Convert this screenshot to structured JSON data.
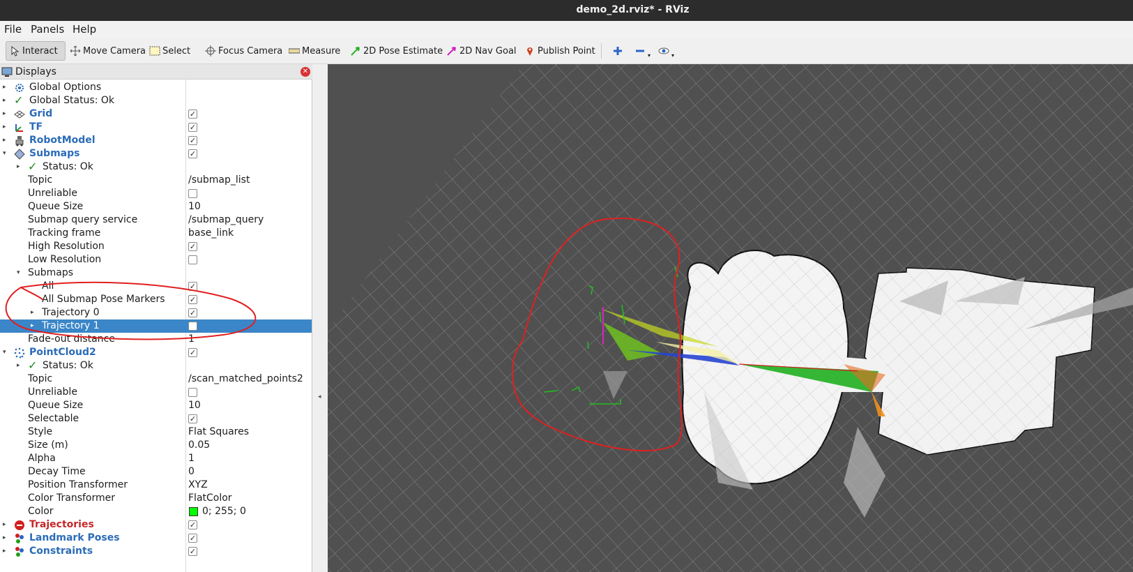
{
  "window": {
    "title": "demo_2d.rviz* - RViz"
  },
  "menubar": {
    "items": [
      "File",
      "Panels",
      "Help"
    ]
  },
  "toolbar": {
    "tools": [
      {
        "label": "Interact",
        "icon": "cursor-icon",
        "active": true
      },
      {
        "label": "Move Camera",
        "icon": "move-camera-icon"
      },
      {
        "label": "Select",
        "icon": "select-icon"
      },
      {
        "label": "Focus Camera",
        "icon": "focus-camera-icon"
      },
      {
        "label": "Measure",
        "icon": "ruler-icon"
      },
      {
        "label": "2D Pose Estimate",
        "icon": "green-arrow-icon"
      },
      {
        "label": "2D Nav Goal",
        "icon": "magenta-arrow-icon"
      },
      {
        "label": "Publish Point",
        "icon": "pin-icon"
      }
    ]
  },
  "displays": {
    "title": "Displays",
    "rows": [
      {
        "name": "Global Options",
        "value": ""
      },
      {
        "name": "Global Status: Ok",
        "value": ""
      },
      {
        "name": "Grid",
        "value": ""
      },
      {
        "name": "TF",
        "value": ""
      },
      {
        "name": "RobotModel",
        "value": ""
      },
      {
        "name": "Submaps",
        "value": ""
      },
      {
        "name": "Status: Ok",
        "value": ""
      },
      {
        "name": "Topic",
        "value": "/submap_list"
      },
      {
        "name": "Unreliable",
        "value": ""
      },
      {
        "name": "Queue Size",
        "value": "10"
      },
      {
        "name": "Submap query service",
        "value": "/submap_query"
      },
      {
        "name": "Tracking frame",
        "value": "base_link"
      },
      {
        "name": "High Resolution",
        "value": ""
      },
      {
        "name": "Low Resolution",
        "value": ""
      },
      {
        "name": "Submaps",
        "value": ""
      },
      {
        "name": "All",
        "value": ""
      },
      {
        "name": "All Submap Pose Markers",
        "value": ""
      },
      {
        "name": "Trajectory 0",
        "value": ""
      },
      {
        "name": "Trajectory 1",
        "value": ""
      },
      {
        "name": "Fade-out distance",
        "value": "1"
      },
      {
        "name": "PointCloud2",
        "value": ""
      },
      {
        "name": "Status: Ok",
        "value": ""
      },
      {
        "name": "Topic",
        "value": "/scan_matched_points2"
      },
      {
        "name": "Unreliable",
        "value": ""
      },
      {
        "name": "Queue Size",
        "value": "10"
      },
      {
        "name": "Selectable",
        "value": ""
      },
      {
        "name": "Style",
        "value": "Flat Squares"
      },
      {
        "name": "Size (m)",
        "value": "0.05"
      },
      {
        "name": "Alpha",
        "value": "1"
      },
      {
        "name": "Decay Time",
        "value": "0"
      },
      {
        "name": "Position Transformer",
        "value": "XYZ"
      },
      {
        "name": "Color Transformer",
        "value": "FlatColor"
      },
      {
        "name": "Color",
        "value": "0; 255; 0"
      },
      {
        "name": "Trajectories",
        "value": ""
      },
      {
        "name": "Landmark Poses",
        "value": ""
      },
      {
        "name": "Constraints",
        "value": ""
      }
    ]
  },
  "colors": {
    "selection": "#3a86c8",
    "display_name_blue": "#2b6cb8",
    "error_red": "#c62828",
    "pointcloud_color": "#00ff00",
    "annotation_red": "#e02020",
    "viewport_bg": "#505050"
  }
}
